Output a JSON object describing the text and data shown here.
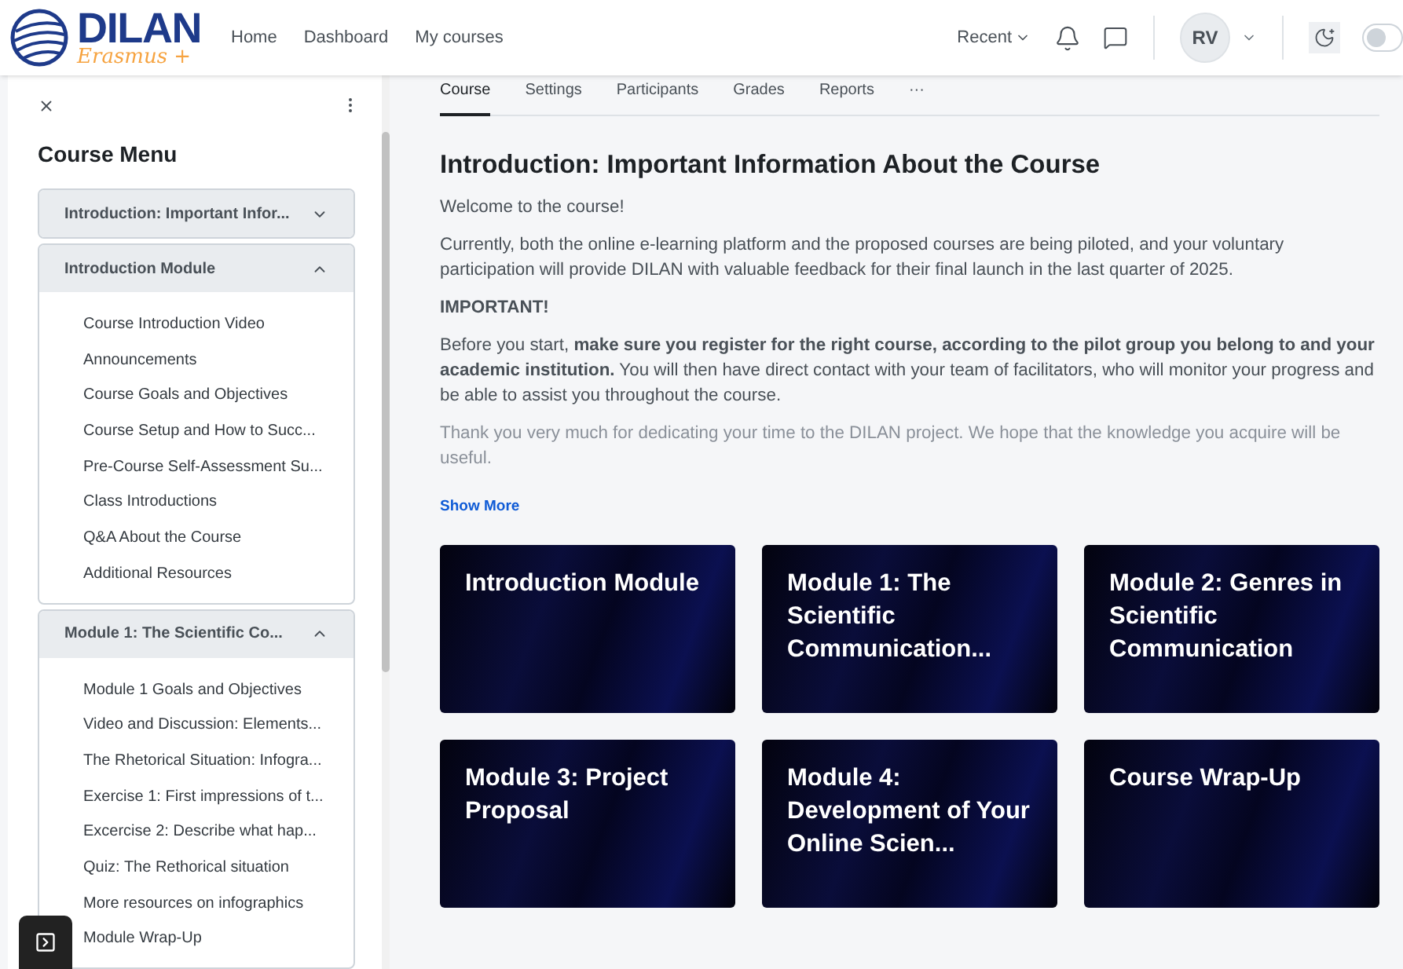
{
  "logo": {
    "name": "DILAN",
    "tagline": "Erasmus +"
  },
  "nav": [
    "Home",
    "Dashboard",
    "My courses"
  ],
  "header": {
    "recent": "Recent",
    "avatar": "RV",
    "dark_mode": false
  },
  "drawer": {
    "title": "Course Menu",
    "sections": [
      {
        "title": "Introduction: Important Infor...",
        "expanded": false
      },
      {
        "title": "Introduction Module",
        "expanded": true,
        "items": [
          "Course Introduction Video",
          "Announcements",
          "Course Goals and Objectives",
          "Course Setup and How to Succ...",
          "Pre-Course Self-Assessment Su...",
          "Class Introductions",
          "Q&A About the Course",
          "Additional Resources"
        ]
      },
      {
        "title": "Module 1: The Scientific Co...",
        "expanded": true,
        "items": [
          "Module 1 Goals and Objectives",
          "Video and Discussion: Elements...",
          "The Rhetorical Situation: Infogra...",
          "Exercise 1: First impressions of t...",
          "Excercise 2: Describe what hap...",
          "Quiz: The Rethorical situation",
          "More resources on infographics",
          "Module Wrap-Up"
        ]
      }
    ]
  },
  "tabs": [
    {
      "label": "Course",
      "selected": true
    },
    {
      "label": "Settings",
      "selected": false
    },
    {
      "label": "Participants",
      "selected": false
    },
    {
      "label": "Grades",
      "selected": false
    },
    {
      "label": "Reports",
      "selected": false
    },
    {
      "label": "···",
      "selected": false
    }
  ],
  "heading": "Introduction: Important Information About the Course",
  "paragraphs": [
    "Welcome to the course!",
    "Currently, both the online e-learning platform and the proposed courses are being piloted, and your voluntary participation will provide DILAN with valuable feedback for their final launch in the last quarter of 2025.",
    "**IMPORTANT!**",
    "Before you start, **make sure you register for the right course, according to the pilot group you belong to and your academic institution.** You will then have direct contact with your team of facilitators, who will monitor your progress and be able to assist you throughout the course.",
    "Thank you very much for dedicating your time to the DILAN project. We hope that the knowledge you acquire will be useful."
  ],
  "show_more": "Show More",
  "cards": [
    "Introduction Module",
    "Module 1: The Scientific Communication...",
    "Module 2: Genres in Scientific Communication",
    "Module 3: Project Proposal",
    "Module 4: Development of Your Online Scien...",
    "Course Wrap-Up"
  ]
}
